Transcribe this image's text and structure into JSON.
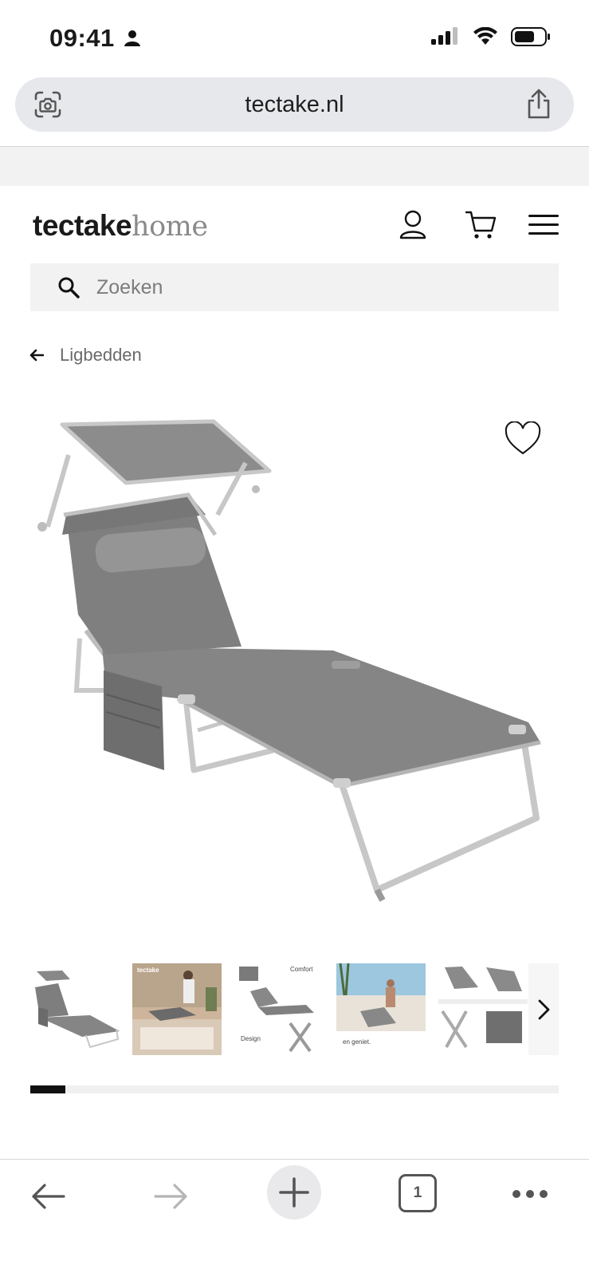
{
  "status": {
    "time": "09:41"
  },
  "browser": {
    "url": "tectake.nl",
    "tab_count": "1"
  },
  "site": {
    "logo_primary": "tectake",
    "logo_secondary": "home",
    "search_placeholder": "Zoeken",
    "breadcrumb": "Ligbedden"
  },
  "gallery": {
    "thumbnails": [
      {
        "name": "thumb-1"
      },
      {
        "name": "thumb-2",
        "caption": "tectake"
      },
      {
        "name": "thumb-3",
        "caption_top": "Comfort",
        "caption_bottom": "Design"
      },
      {
        "name": "thumb-4",
        "caption": "en geniet."
      },
      {
        "name": "thumb-5"
      }
    ],
    "progress": 0.067
  },
  "colors": {
    "accent": "#111111",
    "fabric": "#8a8a8a",
    "frame": "#c8c8c8"
  }
}
